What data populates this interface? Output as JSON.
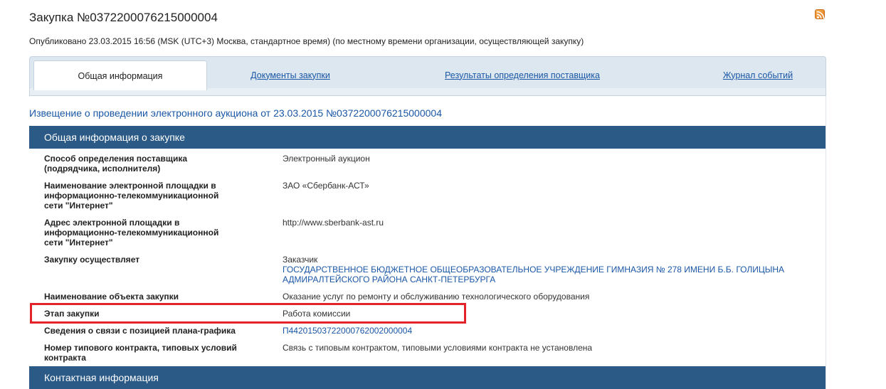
{
  "header": {
    "title": "Закупка №0372200076215000004",
    "published": "Опубликовано 23.03.2015 16:56 (MSK (UTC+3) Москва, стандартное время) (по местному времени организации, осуществляющей закупку)"
  },
  "tabs": [
    {
      "label": "Общая информация",
      "active": true
    },
    {
      "label": "Документы закупки",
      "active": false
    },
    {
      "label": "Результаты определения поставщика",
      "active": false
    },
    {
      "label": "Журнал событий",
      "active": false
    }
  ],
  "notice_link": "Извещение о проведении электронного аукциона от 23.03.2015 №0372200076215000004",
  "sections": {
    "general_title": "Общая информация о закупке",
    "contact_title": "Контактная информация"
  },
  "rows": [
    {
      "label_lines": [
        "Способ определения поставщика",
        "(подрядчика, исполнителя)"
      ],
      "value": "Электронный аукцион"
    },
    {
      "label_lines": [
        "Наименование электронной площадки в",
        "информационно-телекоммуникационной",
        "сети \"Интернет\""
      ],
      "value": "ЗАО «Сбербанк-АСТ»"
    },
    {
      "label_lines": [
        "Адрес электронной площадки в",
        "информационно-телекоммуникационной",
        "сети \"Интернет\""
      ],
      "value": "http://www.sberbank-ast.ru"
    },
    {
      "label_lines": [
        "Закупку осуществляет"
      ],
      "value": "Заказчик",
      "org_link_lines": [
        "ГОСУДАРСТВЕННОЕ БЮДЖЕТНОЕ ОБЩЕОБРАЗОВАТЕЛЬНОЕ УЧРЕЖДЕНИЕ ГИМНАЗИЯ № 278 ИМЕНИ Б.Б. ГОЛИЦЫНА",
        "АДМИРАЛТЕЙСКОГО РАЙОНА САНКТ-ПЕТЕРБУРГА"
      ]
    },
    {
      "label_lines": [
        "Наименование объекта закупки"
      ],
      "value": "Оказание услуг по ремонту и обслуживанию технологического оборудования"
    },
    {
      "label_lines": [
        "Этап закупки"
      ],
      "value": "Работа комиссии"
    },
    {
      "label_lines": [
        "Сведения о связи с позицией плана-графика"
      ],
      "value": "П44201503722000762002000004"
    },
    {
      "label_lines": [
        "Номер типового контракта, типовых условий",
        "контракта"
      ],
      "value": "Связь с типовым контрактом, типовыми условиями контракта не установлена"
    }
  ],
  "icons": {
    "rss": "rss-feed-icon"
  },
  "colors": {
    "section_header": "#2b5a86",
    "link": "#1a57a6",
    "highlight": "#e2232a",
    "tabs_bg": "#dde7ef"
  }
}
